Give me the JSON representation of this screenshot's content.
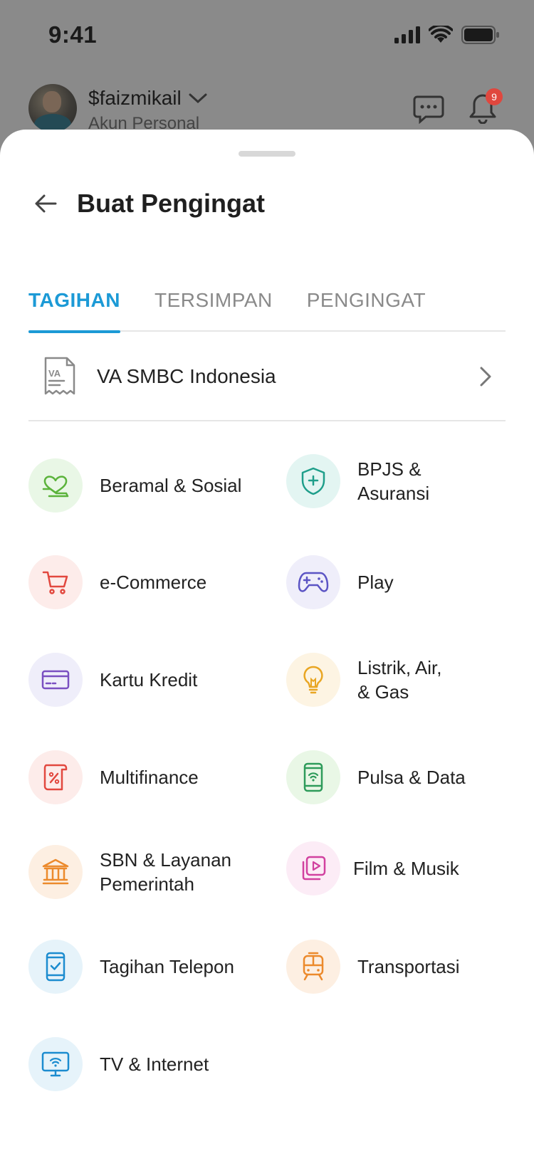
{
  "status_bar": {
    "time": "9:41"
  },
  "profile": {
    "name": "$faizmikail",
    "subtitle": "Akun Personal",
    "notification_count": "9"
  },
  "sheet": {
    "title": "Buat Pengingat",
    "tabs": [
      {
        "label": "TAGIHAN",
        "active": true
      },
      {
        "label": "TERSIMPAN",
        "active": false
      },
      {
        "label": "PENGINGAT",
        "active": false
      }
    ],
    "va_item": {
      "label": "VA SMBC Indonesia",
      "icon": "va-receipt-icon"
    },
    "categories": [
      {
        "label": "Beramal & Sosial",
        "icon": "heart-hand-icon",
        "bg": "#e9f7e6",
        "color": "#5bb33b"
      },
      {
        "label": "BPJS &\nAsuransi",
        "icon": "shield-plus-icon",
        "bg": "#e3f5f2",
        "color": "#1e9e8a"
      },
      {
        "label": "e-Commerce",
        "icon": "cart-icon",
        "bg": "#fdecea",
        "color": "#e2483f"
      },
      {
        "label": "Play",
        "icon": "gamepad-icon",
        "bg": "#efeefa",
        "color": "#5b54c4"
      },
      {
        "label": "Kartu Kredit",
        "icon": "credit-card-icon",
        "bg": "#efeefa",
        "color": "#7a4fc1"
      },
      {
        "label": "Listrik, Air,\n& Gas",
        "icon": "lightbulb-icon",
        "bg": "#fdf4e3",
        "color": "#e9a623"
      },
      {
        "label": "Multifinance",
        "icon": "percent-doc-icon",
        "bg": "#fdecea",
        "color": "#e2483f"
      },
      {
        "label": "Pulsa & Data",
        "icon": "phone-wifi-icon",
        "bg": "#e9f7e6",
        "color": "#2e9b5a"
      },
      {
        "label": "SBN & Layanan\nPemerintah",
        "icon": "bank-icon",
        "bg": "#fdefe2",
        "color": "#ec8a2c"
      },
      {
        "label": "Film & Musik",
        "icon": "play-stack-icon",
        "bg": "#fcecf6",
        "color": "#d1419f"
      },
      {
        "label": "Tagihan Telepon",
        "icon": "phone-check-icon",
        "bg": "#e6f3fa",
        "color": "#1c8ccf"
      },
      {
        "label": "Transportasi",
        "icon": "train-icon",
        "bg": "#fdefe2",
        "color": "#ec8a2c"
      },
      {
        "label": "TV & Internet",
        "icon": "monitor-wifi-icon",
        "bg": "#e6f3fa",
        "color": "#1c8ccf"
      }
    ]
  }
}
